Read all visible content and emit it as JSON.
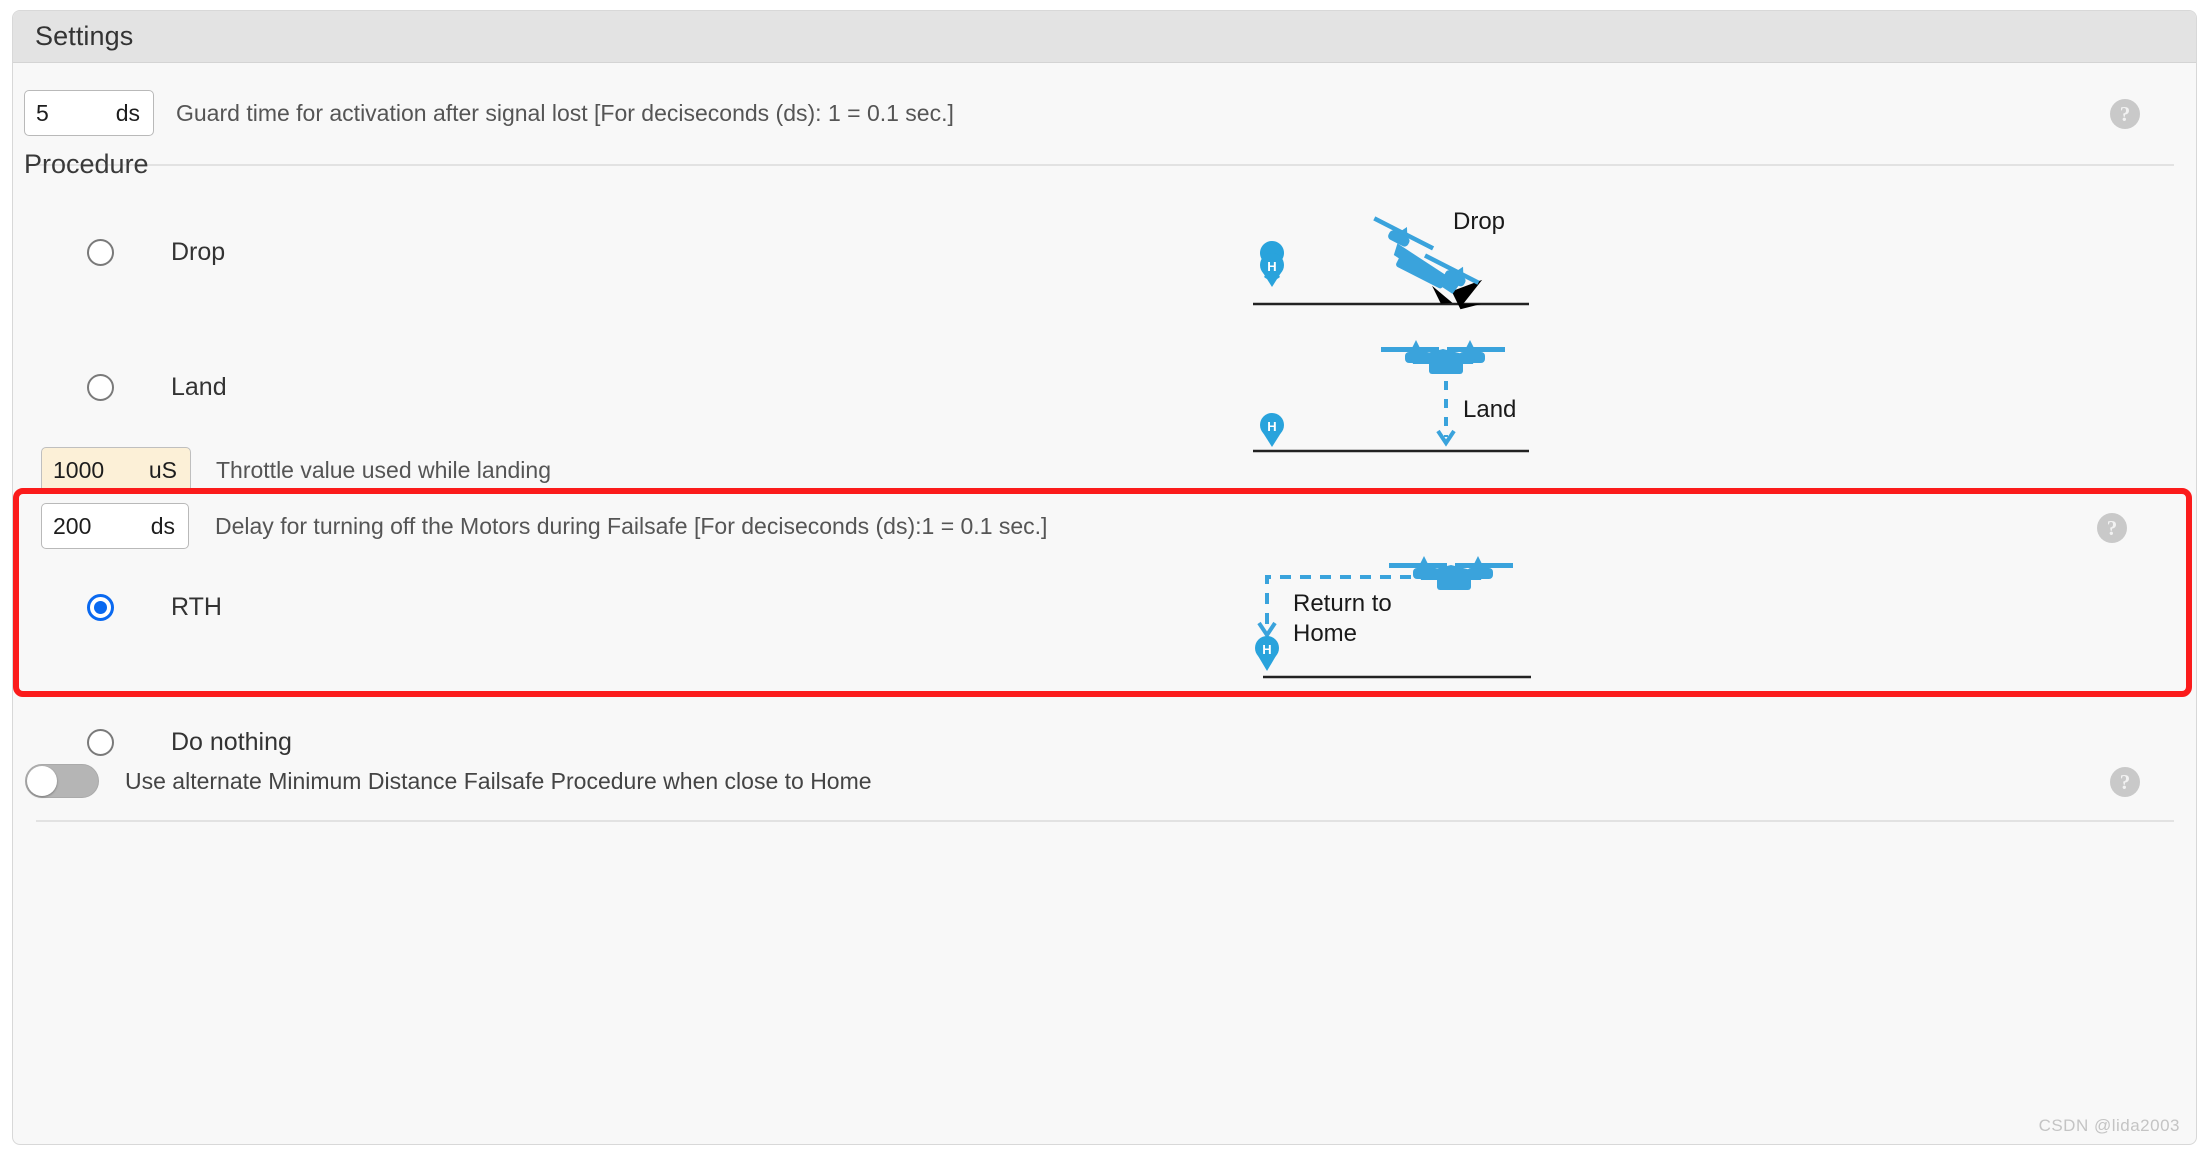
{
  "panel": {
    "title": "Settings"
  },
  "guard_time": {
    "value": "5",
    "unit": "ds",
    "description": "Guard time for activation after signal lost [For deciseconds (ds): 1 = 0.1 sec.]",
    "help_icon": "question-mark-icon",
    "help_glyph": "?"
  },
  "procedure": {
    "label": "Procedure",
    "options": [
      {
        "id": "drop",
        "label": "Drop",
        "selected": false
      },
      {
        "id": "land",
        "label": "Land",
        "selected": false
      },
      {
        "id": "rth",
        "label": "RTH",
        "selected": true
      },
      {
        "id": "do-nothing",
        "label": "Do nothing",
        "selected": false
      }
    ]
  },
  "throttle": {
    "value": "1000",
    "unit": "uS",
    "description": "Throttle value used while landing",
    "modified": true
  },
  "motor_delay": {
    "value": "200",
    "unit": "ds",
    "description": "Delay for turning off the Motors during Failsafe [For deciseconds (ds):1 = 0.1 sec.]",
    "help_icon": "question-mark-icon",
    "help_glyph": "?"
  },
  "alternate_procedure": {
    "label": "Use alternate Minimum Distance Failsafe Procedure when close to Home",
    "enabled": false,
    "help_icon": "question-mark-icon",
    "help_glyph": "?"
  },
  "illustrations": {
    "drop": {
      "caption": "Drop",
      "home_marker": "H"
    },
    "land": {
      "caption": "Land",
      "home_marker": "H"
    },
    "rth": {
      "caption_line1": "Return to",
      "caption_line2": "Home",
      "home_marker": "H"
    }
  },
  "colors": {
    "drone_blue": "#3aa3dc",
    "accent_red": "#fb1b1b",
    "radio_blue": "#0a69f0",
    "modified_field": "#fcf0d7",
    "panel_header": "#e3e3e3"
  },
  "watermark": "CSDN @lida2003"
}
